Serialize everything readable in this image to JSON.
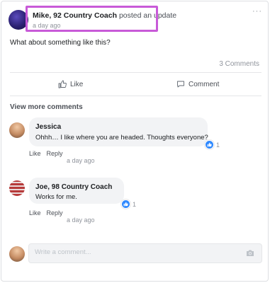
{
  "post": {
    "author": "Mike, 92 Country Coach",
    "action": "posted an update",
    "time": "a day ago",
    "text": "What about something like this?",
    "comment_count": "3 Comments"
  },
  "actions": {
    "like_label": "Like",
    "comment_label": "Comment"
  },
  "view_more": "View more comments",
  "comments": [
    {
      "name": "Jessica",
      "text": "Ohhh… I like where you are headed. Thoughts everyone?",
      "reaction_count": "1",
      "like_label": "Like",
      "reply_label": "Reply",
      "time": "a day ago"
    },
    {
      "name": "Joe, 98 Country Coach",
      "text": "Works for me.",
      "reaction_count": "1",
      "like_label": "Like",
      "reply_label": "Reply",
      "time": "a day ago"
    }
  ],
  "composer": {
    "placeholder": "Write a comment..."
  },
  "icons": {
    "more": "more-options-icon",
    "like": "thumbs-up-icon",
    "comment": "speech-bubble-icon",
    "reaction": "like-reaction-icon",
    "camera": "camera-icon"
  },
  "colors": {
    "highlight": "#c85ad8",
    "reaction_blue": "#2d88ff",
    "bubble_bg": "#f2f3f5"
  }
}
